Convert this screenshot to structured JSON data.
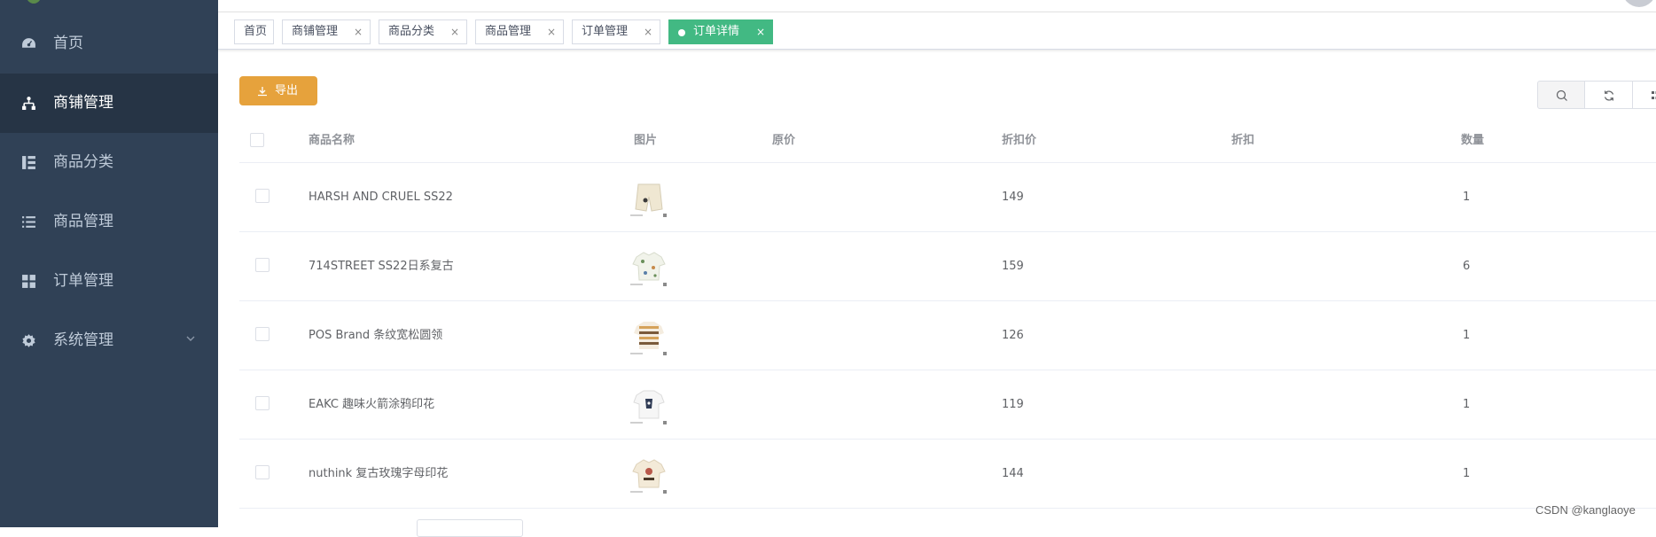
{
  "sidebar": {
    "items": [
      {
        "label": "首页",
        "icon": "dashboard-icon",
        "active": false
      },
      {
        "label": "商铺管理",
        "icon": "tree-icon",
        "active": true
      },
      {
        "label": "商品分类",
        "icon": "category-icon",
        "active": false
      },
      {
        "label": "商品管理",
        "icon": "list-icon",
        "active": false
      },
      {
        "label": "订单管理",
        "icon": "grid-icon",
        "active": false
      },
      {
        "label": "系统管理",
        "icon": "gear-icon",
        "active": false,
        "has_submenu": true
      }
    ]
  },
  "tags": [
    {
      "label": "首页",
      "closable": false,
      "active": false
    },
    {
      "label": "商铺管理",
      "closable": true,
      "active": false
    },
    {
      "label": "商品分类",
      "closable": true,
      "active": false
    },
    {
      "label": "商品管理",
      "closable": true,
      "active": false
    },
    {
      "label": "订单管理",
      "closable": true,
      "active": false
    },
    {
      "label": "订单详情",
      "closable": true,
      "active": true
    }
  ],
  "close_glyph": "×",
  "toolbar": {
    "export_label": "导出",
    "tools": [
      "search-icon",
      "refresh-icon",
      "columns-icon"
    ]
  },
  "table": {
    "columns": [
      "商品名称",
      "图片",
      "原价",
      "折扣价",
      "折扣",
      "数量"
    ],
    "rows": [
      {
        "name": "HARSH AND CRUEL SS22",
        "original_price": "",
        "discount_price": "149",
        "discount": "",
        "quantity": "1",
        "image": "shorts"
      },
      {
        "name": "714STREET SS22日系复古",
        "original_price": "",
        "discount_price": "159",
        "discount": "",
        "quantity": "6",
        "image": "floral-shirt"
      },
      {
        "name": "POS Brand 条纹宽松圆领",
        "original_price": "",
        "discount_price": "126",
        "discount": "",
        "quantity": "1",
        "image": "striped-tee"
      },
      {
        "name": "EAKC 趣味火箭涂鸦印花",
        "original_price": "",
        "discount_price": "119",
        "discount": "",
        "quantity": "1",
        "image": "white-tee"
      },
      {
        "name": "nuthink 复古玫瑰字母印花",
        "original_price": "",
        "discount_price": "144",
        "discount": "",
        "quantity": "1",
        "image": "rose-shirt"
      }
    ]
  },
  "watermark": "CSDN @kanglaoye",
  "colors": {
    "sidebar_bg": "#304156",
    "sidebar_active_bg": "#263445",
    "tag_active": "#42b983",
    "export_button": "#e6a23c"
  }
}
